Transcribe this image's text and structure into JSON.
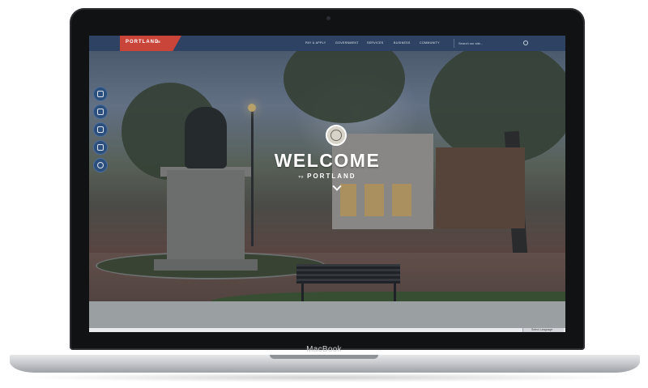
{
  "device": {
    "brand_label": "MacBook"
  },
  "navbar": {
    "logo_text": "PORTLAND",
    "logo_sub": "ME",
    "items": [
      "PAY & APPLY",
      "GOVERNMENT",
      "SERVICES",
      "BUSINESS",
      "COMMUNITY"
    ],
    "search_placeholder": "Search our site..."
  },
  "hero": {
    "headline": "WELCOME",
    "sub_prefix": "TO",
    "sub_text": "PORTLAND"
  },
  "side_buttons": [
    "chat-icon",
    "calendar-icon",
    "mail-icon",
    "id-card-icon",
    "accessibility-icon"
  ],
  "footer": {
    "language_label": "Select Language"
  },
  "colors": {
    "nav": "#2e4363",
    "logo": "#c9453a",
    "side_button": "#2c4f7c"
  }
}
